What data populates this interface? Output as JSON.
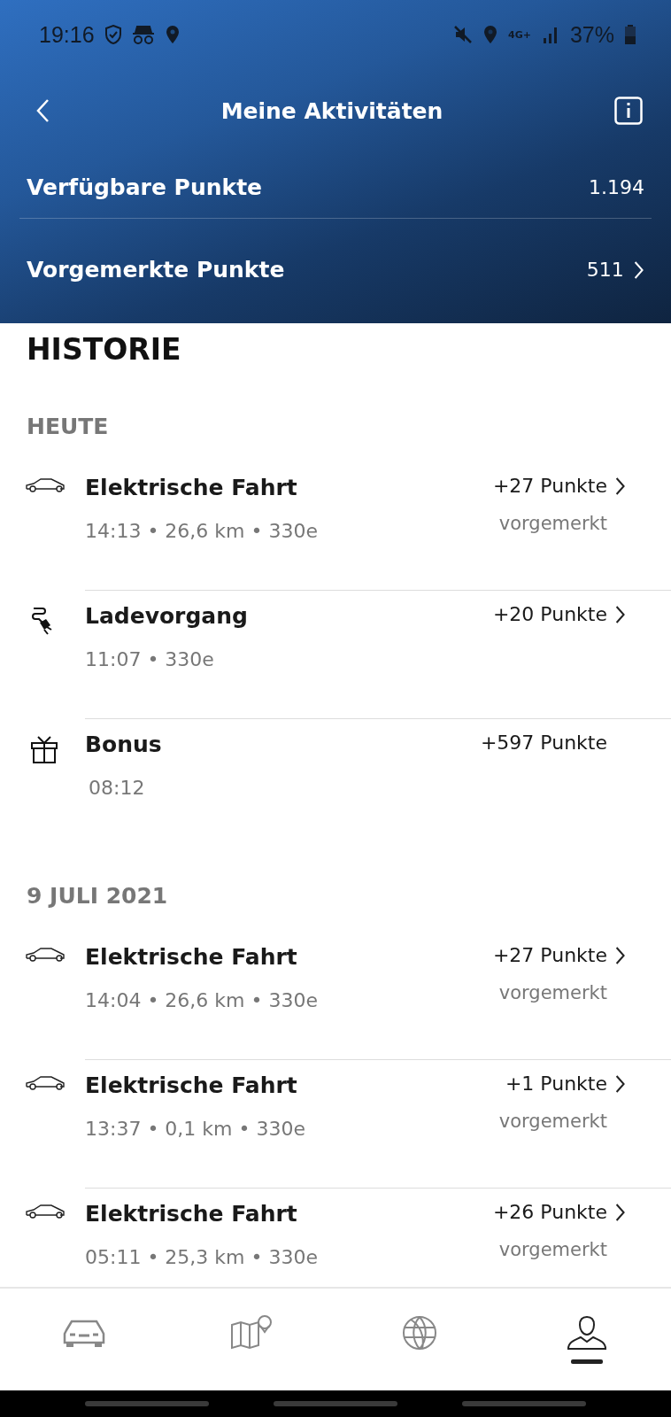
{
  "status_bar": {
    "time": "19:16",
    "network": "4G+",
    "battery": "37%"
  },
  "header": {
    "title": "Meine Aktivitäten"
  },
  "points": [
    {
      "label": "Verfügbare Punkte",
      "value": "1.194",
      "has_chevron": false
    },
    {
      "label": "Vorgemerkte Punkte",
      "value": "511",
      "has_chevron": true
    }
  ],
  "history": {
    "title": "HISTORIE",
    "sections": [
      {
        "heading": "HEUTE",
        "items": [
          {
            "kind": "car",
            "title": "Elektrische Fahrt",
            "details": "14:13 • 26,6 km • 330e",
            "points": "+27 Punkte",
            "status": "vorgemerkt",
            "has_chevron": true
          },
          {
            "kind": "charge",
            "title": "Ladevorgang",
            "details": "11:07 • 330e",
            "points": "+20 Punkte",
            "has_chevron": true
          },
          {
            "kind": "gift",
            "title": "Bonus",
            "details": "08:12",
            "points": "+597 Punkte",
            "has_chevron": false
          }
        ]
      },
      {
        "heading": "9 JULI 2021",
        "items": [
          {
            "kind": "car",
            "title": "Elektrische Fahrt",
            "details": "14:04 • 26,6 km • 330e",
            "points": "+27 Punkte",
            "status": "vorgemerkt",
            "has_chevron": true
          },
          {
            "kind": "car",
            "title": "Elektrische Fahrt",
            "details": "13:37 • 0,1 km • 330e",
            "points": "+1 Punkte",
            "status": "vorgemerkt",
            "has_chevron": true
          },
          {
            "kind": "car",
            "title": "Elektrische Fahrt",
            "details": "05:11 • 25,3 km • 330e",
            "points": "+26 Punkte",
            "status": "vorgemerkt",
            "has_chevron": true
          }
        ]
      }
    ]
  },
  "bottom_nav": [
    {
      "kind": "car",
      "selected": false
    },
    {
      "kind": "map",
      "selected": false
    },
    {
      "kind": "globe",
      "selected": false
    },
    {
      "kind": "profile",
      "selected": true
    }
  ]
}
